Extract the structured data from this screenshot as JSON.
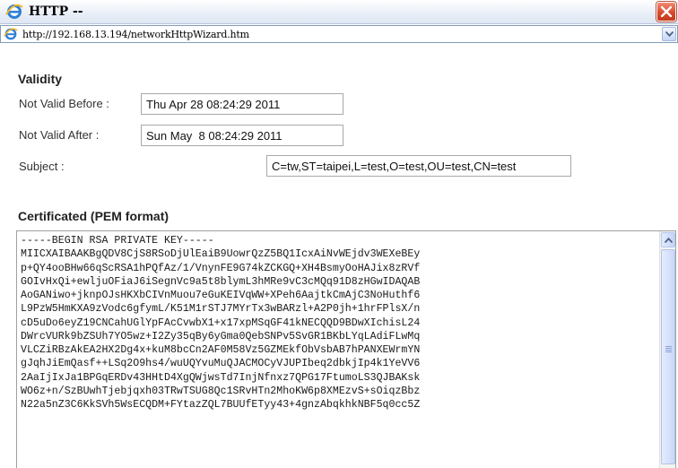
{
  "window": {
    "title": "HTTP --",
    "address_url": "http://192.168.13.194/networkHttpWizard.htm"
  },
  "validity": {
    "heading": "Validity",
    "not_valid_before_label": "Not Valid Before :",
    "not_valid_before_value": "Thu Apr 28 08:24:29 2011",
    "not_valid_after_label": "Not Valid After :",
    "not_valid_after_value": "Sun May  8 08:24:29 2011",
    "subject_label": "Subject :",
    "subject_value": "C=tw,ST=taipei,L=test,O=test,OU=test,CN=test"
  },
  "certificate": {
    "heading": "Certificated (PEM format)",
    "pem_lines": [
      "-----BEGIN RSA PRIVATE KEY-----",
      "MIICXAIBAAKBgQDV8CjS8RSoDjUlEaiB9UowrQzZ5BQ1IcxAiNvWEjdv3WEXeBEy",
      "p+QY4ooBHw66qScRSA1hPQfAz/1/VnynFE9G74kZCKGQ+XH4BsmyOoHAJix8zRVf",
      "GOIvHxQi+ewljuOFiaJ6iSegnVc9a5t8blymL3hMRe9vC3cMQq91D8zHGwIDAQAB",
      "AoGANiwo+jknpOJsHKXbCIVnMuou7eGuKEIVqWW+XPeh6AajtkCmAjC3NoHuthf6",
      "L9PzW5HmKXA9zVodc6gfymL/K51M1rSTJ7MYrTx3wBARzl+A2P0jh+1hrFPlsX/n",
      "cD5uDo6eyZ19CNCahUGlYpFAcCvwbX1+x17xpMSqGF41kNECQQD9BDwXIchisL24",
      "DWrcVURk9bZSUh7YO5wz+I2Zy35qBy6yGma0QebSNPv5SvGR1BKbLYqLAdiFLwMq",
      "VLCZiRBzAkEA2HX2Dg4x+kuM8bcCn2AF0M58Vz5GZMEkfObVsbAB7hPANXEWrmYN",
      "gJqhJiEmQasf++LSq2O9hs4/wuUQYvuMuQJACMOCyVJUPIbeq2dbkjIp4k1YeVV6",
      "2AaIjIxJa1BPGqERDv43HHtD4XgQWjwsTd7InjNfnxz7QPG17FtumoLS3QJBAKsk",
      "WO6z+n/SzBUwhTjebjqxh03TRwTSUG8Qc1SRvHTn2MhoKW6p8XMEzvS+sOiqzBbz",
      "N22a5nZ3C6KkSVh5WsECQDM+FYtazZQL7BUUfETyy43+4gnzAbqkhkNBF5q0cc5Z"
    ]
  }
}
